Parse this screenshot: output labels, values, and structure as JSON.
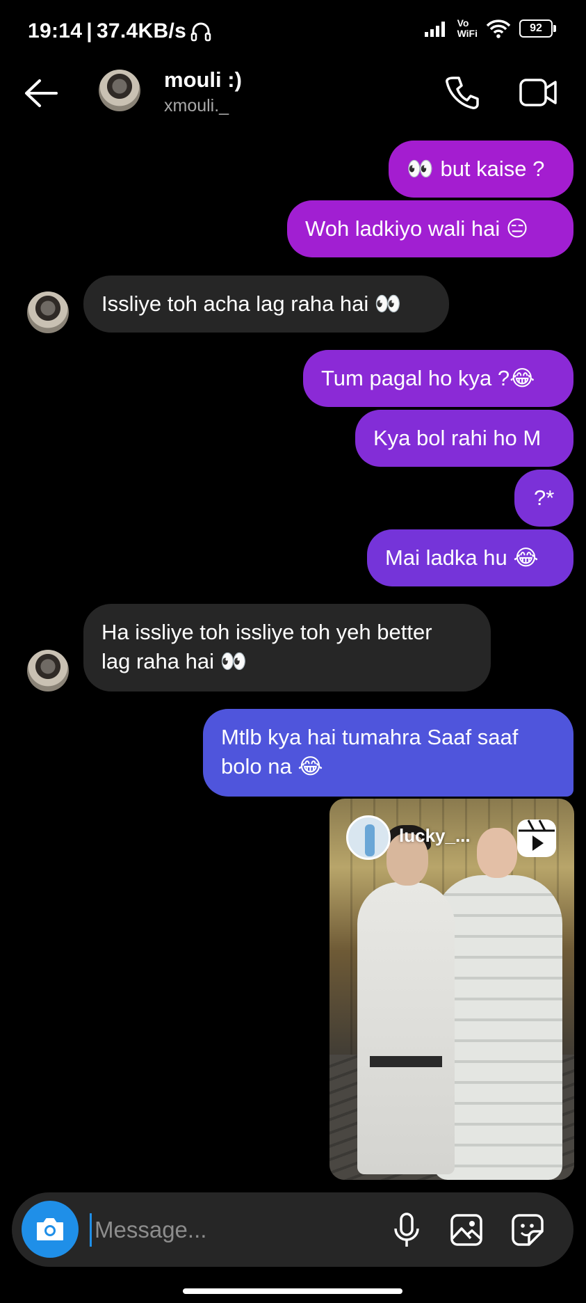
{
  "status_bar": {
    "time": "19:14",
    "separator": "|",
    "speed": "37.4KB/s",
    "vowifi_line1": "Vo",
    "vowifi_line2": "WiFi",
    "battery": "92"
  },
  "header": {
    "name": "mouli :)",
    "username": "xmouli._"
  },
  "messages": [
    {
      "from": "me",
      "text": "but kaise ?",
      "emoji_prefix": "👀"
    },
    {
      "from": "me",
      "text": "Woh ladkiyo wali hai ",
      "emoji_suffix": "😑"
    },
    {
      "from": "them",
      "text": "Issliye toh acha lag raha hai ",
      "emoji_suffix": "👀"
    },
    {
      "from": "me",
      "text": "Tum pagal ho kya ?",
      "emoji_suffix": "😂"
    },
    {
      "from": "me",
      "text": "Kya bol rahi ho M"
    },
    {
      "from": "me",
      "text": "?*"
    },
    {
      "from": "me",
      "text": "Mai ladka hu ",
      "emoji_suffix": "😂"
    },
    {
      "from": "them",
      "line1": "Ha issliye toh issliye toh yeh better",
      "line2": "lag raha hai ",
      "emoji_suffix": "👀"
    },
    {
      "from": "me",
      "line1": "Mtlb kya hai tumahra Saaf saaf",
      "line2": "bolo na ",
      "emoji_suffix": "😂"
    }
  ],
  "reel": {
    "username": "lucky_..."
  },
  "composer": {
    "placeholder": "Message..."
  },
  "colors": {
    "bubble_top": "#a41dd0",
    "bubble_mid": "#8a2ad6",
    "bubble_bottom": "#4f55dc",
    "received": "#262626",
    "camera": "#1f8fe8"
  },
  "icons": [
    "back-arrow-icon",
    "phone-icon",
    "video-camera-icon",
    "camera-icon",
    "microphone-icon",
    "gallery-icon",
    "sticker-icon",
    "reels-icon",
    "headphones-icon",
    "signal-icon",
    "wifi-icon",
    "battery-icon"
  ]
}
